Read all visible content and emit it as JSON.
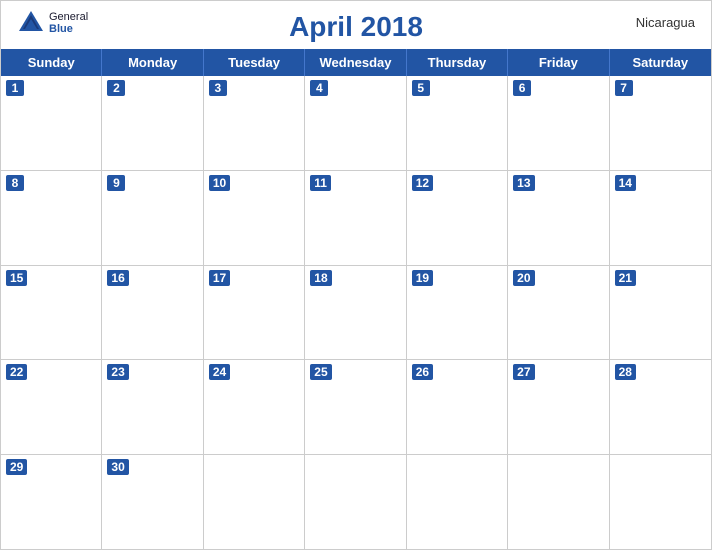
{
  "header": {
    "title": "April 2018",
    "country": "Nicaragua",
    "logo": {
      "general": "General",
      "blue": "Blue"
    }
  },
  "days_of_week": [
    "Sunday",
    "Monday",
    "Tuesday",
    "Wednesday",
    "Thursday",
    "Friday",
    "Saturday"
  ],
  "weeks": [
    [
      {
        "date": 1,
        "empty": false
      },
      {
        "date": 2,
        "empty": false
      },
      {
        "date": 3,
        "empty": false
      },
      {
        "date": 4,
        "empty": false
      },
      {
        "date": 5,
        "empty": false
      },
      {
        "date": 6,
        "empty": false
      },
      {
        "date": 7,
        "empty": false
      }
    ],
    [
      {
        "date": 8,
        "empty": false
      },
      {
        "date": 9,
        "empty": false
      },
      {
        "date": 10,
        "empty": false
      },
      {
        "date": 11,
        "empty": false
      },
      {
        "date": 12,
        "empty": false
      },
      {
        "date": 13,
        "empty": false
      },
      {
        "date": 14,
        "empty": false
      }
    ],
    [
      {
        "date": 15,
        "empty": false
      },
      {
        "date": 16,
        "empty": false
      },
      {
        "date": 17,
        "empty": false
      },
      {
        "date": 18,
        "empty": false
      },
      {
        "date": 19,
        "empty": false
      },
      {
        "date": 20,
        "empty": false
      },
      {
        "date": 21,
        "empty": false
      }
    ],
    [
      {
        "date": 22,
        "empty": false
      },
      {
        "date": 23,
        "empty": false
      },
      {
        "date": 24,
        "empty": false
      },
      {
        "date": 25,
        "empty": false
      },
      {
        "date": 26,
        "empty": false
      },
      {
        "date": 27,
        "empty": false
      },
      {
        "date": 28,
        "empty": false
      }
    ],
    [
      {
        "date": 29,
        "empty": false
      },
      {
        "date": 30,
        "empty": false
      },
      {
        "date": null,
        "empty": true
      },
      {
        "date": null,
        "empty": true
      },
      {
        "date": null,
        "empty": true
      },
      {
        "date": null,
        "empty": true
      },
      {
        "date": null,
        "empty": true
      }
    ]
  ],
  "colors": {
    "header_blue": "#2255a4",
    "accent": "#2255a4"
  }
}
